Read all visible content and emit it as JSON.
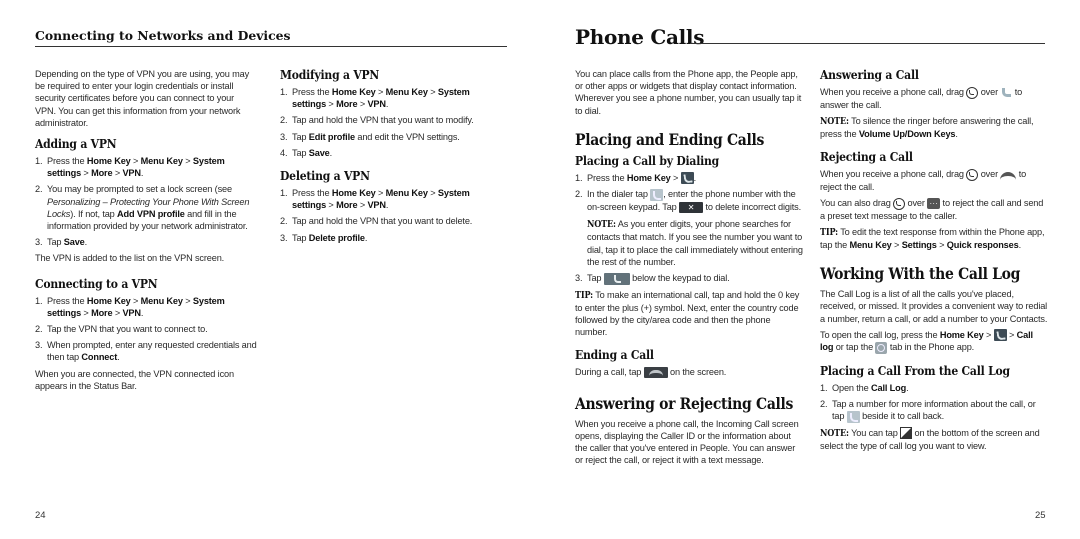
{
  "left_page": {
    "running_head": "Connecting to Networks and Devices",
    "intro": "Depending on the type of VPN you are using, you may be required to enter your login credentials or install security certificates before you can connect to your VPN. You can get this information from your network administrator.",
    "adding": {
      "heading": "Adding a VPN",
      "step1_pre": "Press the ",
      "home_key": "Home Key",
      "sep": " > ",
      "menu_key": "Menu Key",
      "system_settings": "System settings",
      "more": "More",
      "vpn": "VPN",
      "step2_a": "You may be prompted to set a lock screen (see ",
      "step2_ital": "Personalizing – Protecting Your Phone With Screen Locks",
      "step2_b": "). If not, tap ",
      "step2_bold": "Add VPN profile",
      "step2_c": " and fill in the information provided by your network administrator.",
      "step3_pre": "Tap ",
      "save": "Save",
      "after": "The VPN is added to the list on the VPN screen."
    },
    "connecting": {
      "heading": "Connecting to a VPN",
      "step2": "Tap the VPN that you want to connect to.",
      "step3_pre": "When prompted, enter any requested credentials and then tap ",
      "connect": "Connect",
      "after": "When you are connected, the VPN connected icon appears in the Status Bar."
    },
    "modifying": {
      "heading": "Modifying a VPN",
      "step2": "Tap and hold the VPN that you want to modify.",
      "step3_pre": "Tap ",
      "edit_profile": "Edit profile",
      "step3_post": " and edit the VPN settings.",
      "step4_pre": "Tap ",
      "save": "Save"
    },
    "deleting": {
      "heading": "Deleting a VPN",
      "step2": "Tap and hold the VPN that you want to delete.",
      "step3_pre": "Tap ",
      "delete_profile": "Delete profile"
    },
    "page_number": "24"
  },
  "right_page": {
    "title": "Phone Calls",
    "intro": "You can place calls from the Phone app, the People app, or other apps or widgets that display contact information. Wherever you see a phone number, you can usually tap it to dial.",
    "placing_ending": {
      "heading": "Placing and Ending Calls",
      "dialing_heading": "Placing a Call by Dialing",
      "step1_pre": "Press the ",
      "home_key": "Home Key",
      "sep": " > ",
      "step2_a": "In the dialer tap ",
      "step2_b": ", enter the phone number with the on-screen keypad. Tap ",
      "step2_c": " to delete incorrect digits.",
      "note_label": "NOTE:",
      "note_text": " As you enter digits, your phone searches for contacts that match. If you see the number you want to dial, tap it to place the call immediately without entering the rest of the number.",
      "step3_pre": "Tap ",
      "step3_post": " below the keypad to dial.",
      "tip_label": "TIP:",
      "tip_text": " To make an international call, tap and hold the 0 key to enter the plus (+) symbol. Next, enter the country code followed by the city/area code and then the phone number.",
      "ending_heading": "Ending a Call",
      "ending_pre": "During a call, tap ",
      "ending_post": " on the screen."
    },
    "answering_rejecting": {
      "heading": "Answering or Rejecting Calls",
      "text": "When you receive a phone call, the Incoming Call screen opens, displaying the Caller ID or the information about the caller that you've entered in People. You can answer or reject the call, or reject it with a text message."
    },
    "answering": {
      "heading": "Answering a Call",
      "text_a": "When you receive a phone call, drag ",
      "text_b": " over ",
      "text_c": " to answer the call.",
      "note_label": "NOTE:",
      "note_text": " To silence the ringer before answering the call, press the ",
      "volume_keys": "Volume Up/Down Keys",
      "period": "."
    },
    "rejecting": {
      "heading": "Rejecting a Call",
      "text_a": "When you receive a phone call, drag ",
      "text_b": " over ",
      "text_c": " to reject the call.",
      "also_a": "You can also drag ",
      "also_b": " over ",
      "also_c": " to reject the call and send a preset text message to the caller.",
      "tip_label": "TIP:",
      "tip_text": " To edit the text response from within the Phone app, tap the ",
      "menu_key": "Menu Key",
      "settings": "Settings",
      "quick_responses": "Quick responses",
      "sep": " > "
    },
    "call_log": {
      "heading": "Working With the Call Log",
      "intro": "The Call Log is a list of all the calls you've placed, received, or missed. It provides a convenient way to redial a number, return a call, or add a number to your Contacts.",
      "open_a": "To open the call log, press the ",
      "home_key": "Home Key",
      "sep": " > ",
      "call_log_bold": "Call log",
      "open_b": " or tap the ",
      "open_c": " tab in the Phone app.",
      "from_heading": "Placing a Call From the Call Log",
      "step1_pre": "Open the ",
      "step1_bold": "Call Log",
      "step2_a": "Tap a number for more information about the call, or tap ",
      "step2_b": " beside it to call back.",
      "note_label": "NOTE:",
      "note_a": " You can tap ",
      "note_b": " on the bottom of the screen and select the type of call log you want to view."
    },
    "page_number": "25"
  },
  "icons": {
    "phone_app": "phone-app-icon",
    "delete_key": "delete-key-icon",
    "dial_button": "dial-button-icon",
    "end_call": "end-call-icon",
    "answer_circle": "answer-circle-icon",
    "handset": "handset-icon",
    "hangup": "hangup-icon",
    "message": "message-icon",
    "call_log_tab": "clock-icon",
    "call_back": "call-back-icon",
    "menu_corner": "menu-corner-icon"
  },
  "glyphs": {
    "delete": "✕"
  }
}
